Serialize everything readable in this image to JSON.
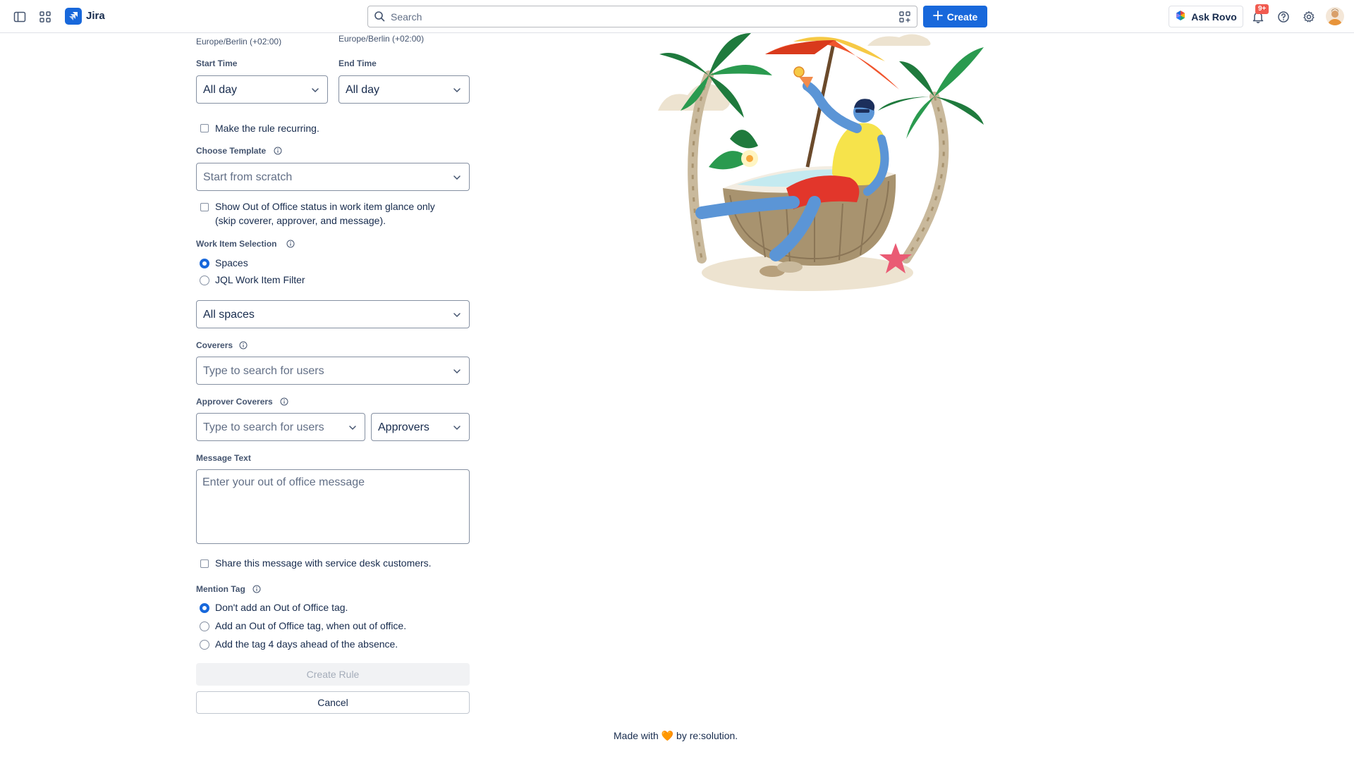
{
  "topbar": {
    "app_name": "Jira",
    "search_placeholder": "Search",
    "create_label": "Create",
    "ask_rovo_label": "Ask Rovo",
    "notification_badge": "9+",
    "icons": [
      "sidebar-toggle-icon",
      "app-switcher-icon",
      "jira-logo-icon",
      "search-icon",
      "filter-icon",
      "plus-icon",
      "rovo-icon",
      "bell-icon",
      "help-icon",
      "gear-icon"
    ]
  },
  "form": {
    "start_timezone": "Europe/Berlin (+02:00)",
    "end_timezone": "Europe/Berlin (+02:00)",
    "start_time_label": "Start Time",
    "end_time_label": "End Time",
    "start_time_value": "All day",
    "end_time_value": "All day",
    "recurring_label": "Make the rule recurring.",
    "template_label": "Choose Template",
    "template_value": "Start from scratch",
    "glance_only_line1": "Show Out of Office status in work item glance only",
    "glance_only_line2": "(skip coverer, approver, and message).",
    "selection_label": "Work Item Selection",
    "selection_options": [
      "Spaces",
      "JQL Work Item Filter"
    ],
    "selection_selected": "Spaces",
    "spaces_value": "All spaces",
    "coverers_label": "Coverers",
    "coverers_placeholder": "Type to search for users",
    "approver_coverers_label": "Approver Coverers",
    "approver_coverers_placeholder": "Type to search for users",
    "approvers_value": "Approvers",
    "message_label": "Message Text",
    "message_placeholder": "Enter your out of office message",
    "share_label": "Share this message with service desk customers.",
    "mention_label": "Mention Tag",
    "mention_options": [
      "Don't add an Out of Office tag.",
      "Add an Out of Office tag, when out of office.",
      "Add the tag 4 days ahead of the absence."
    ],
    "mention_selected": "Don't add an Out of Office tag.",
    "create_rule_label": "Create Rule",
    "cancel_label": "Cancel"
  },
  "footer": {
    "prefix": "Made with",
    "heart": "🧡",
    "suffix": "by re:solution."
  },
  "colors": {
    "accent": "#1868db",
    "badge": "#f15b50",
    "border": "#8590a2",
    "text": "#172b4d",
    "muted": "#44546f"
  }
}
